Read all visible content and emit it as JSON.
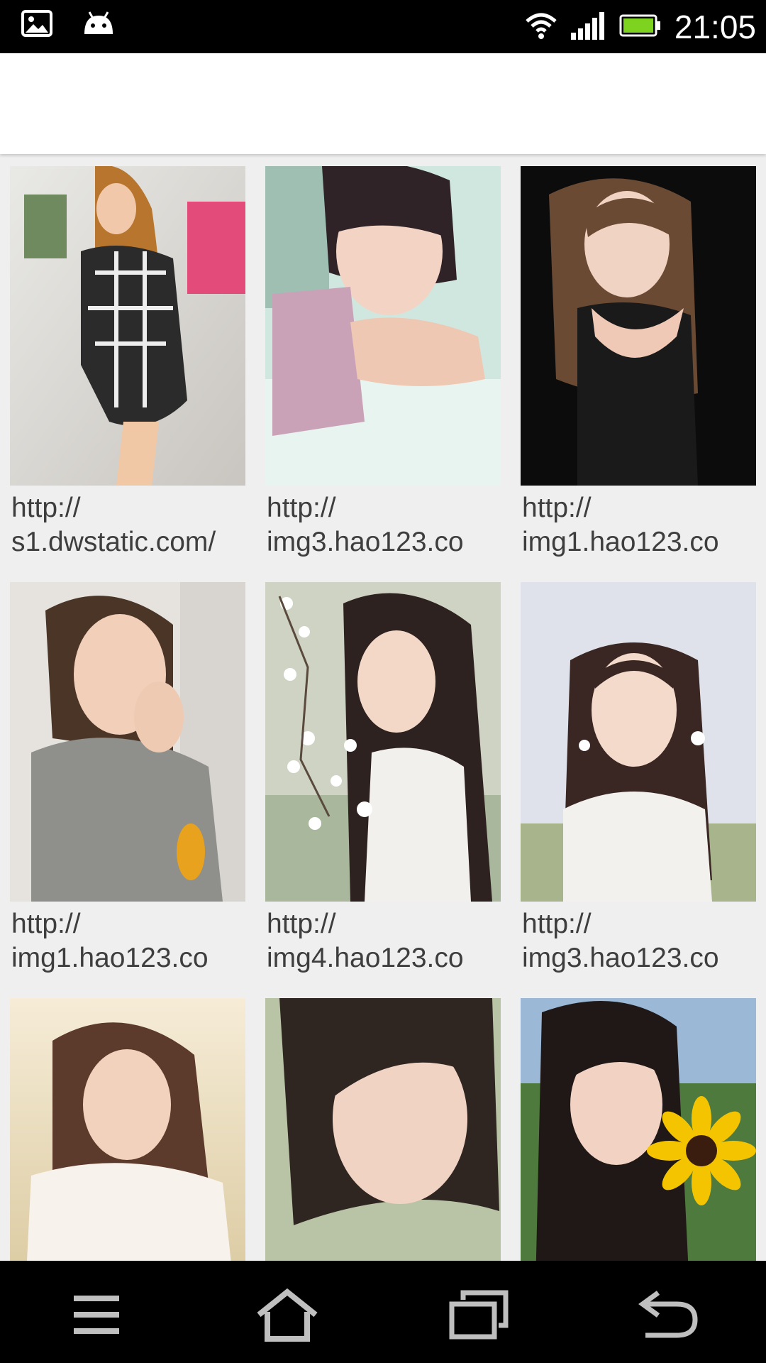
{
  "status_bar": {
    "time": "21:05",
    "icons": [
      "gallery-notification-icon",
      "android-notification-icon",
      "wifi-icon",
      "signal-icon",
      "battery-icon"
    ],
    "battery_color": "#7ed321"
  },
  "action_bar": {},
  "grid": {
    "items": [
      {
        "caption_line1": "http://",
        "caption_line2": "s1.dwstatic.com/"
      },
      {
        "caption_line1": "http://",
        "caption_line2": "img3.hao123.co"
      },
      {
        "caption_line1": "http://",
        "caption_line2": "img1.hao123.co"
      },
      {
        "caption_line1": "http://",
        "caption_line2": "img1.hao123.co"
      },
      {
        "caption_line1": "http://",
        "caption_line2": "img4.hao123.co"
      },
      {
        "caption_line1": "http://",
        "caption_line2": "img3.hao123.co"
      },
      {
        "caption_line1": "",
        "caption_line2": ""
      },
      {
        "caption_line1": "",
        "caption_line2": ""
      },
      {
        "caption_line1": "",
        "caption_line2": ""
      }
    ]
  },
  "nav_bar": {
    "buttons": [
      "menu-icon",
      "home-icon",
      "recent-apps-icon",
      "back-icon"
    ]
  }
}
